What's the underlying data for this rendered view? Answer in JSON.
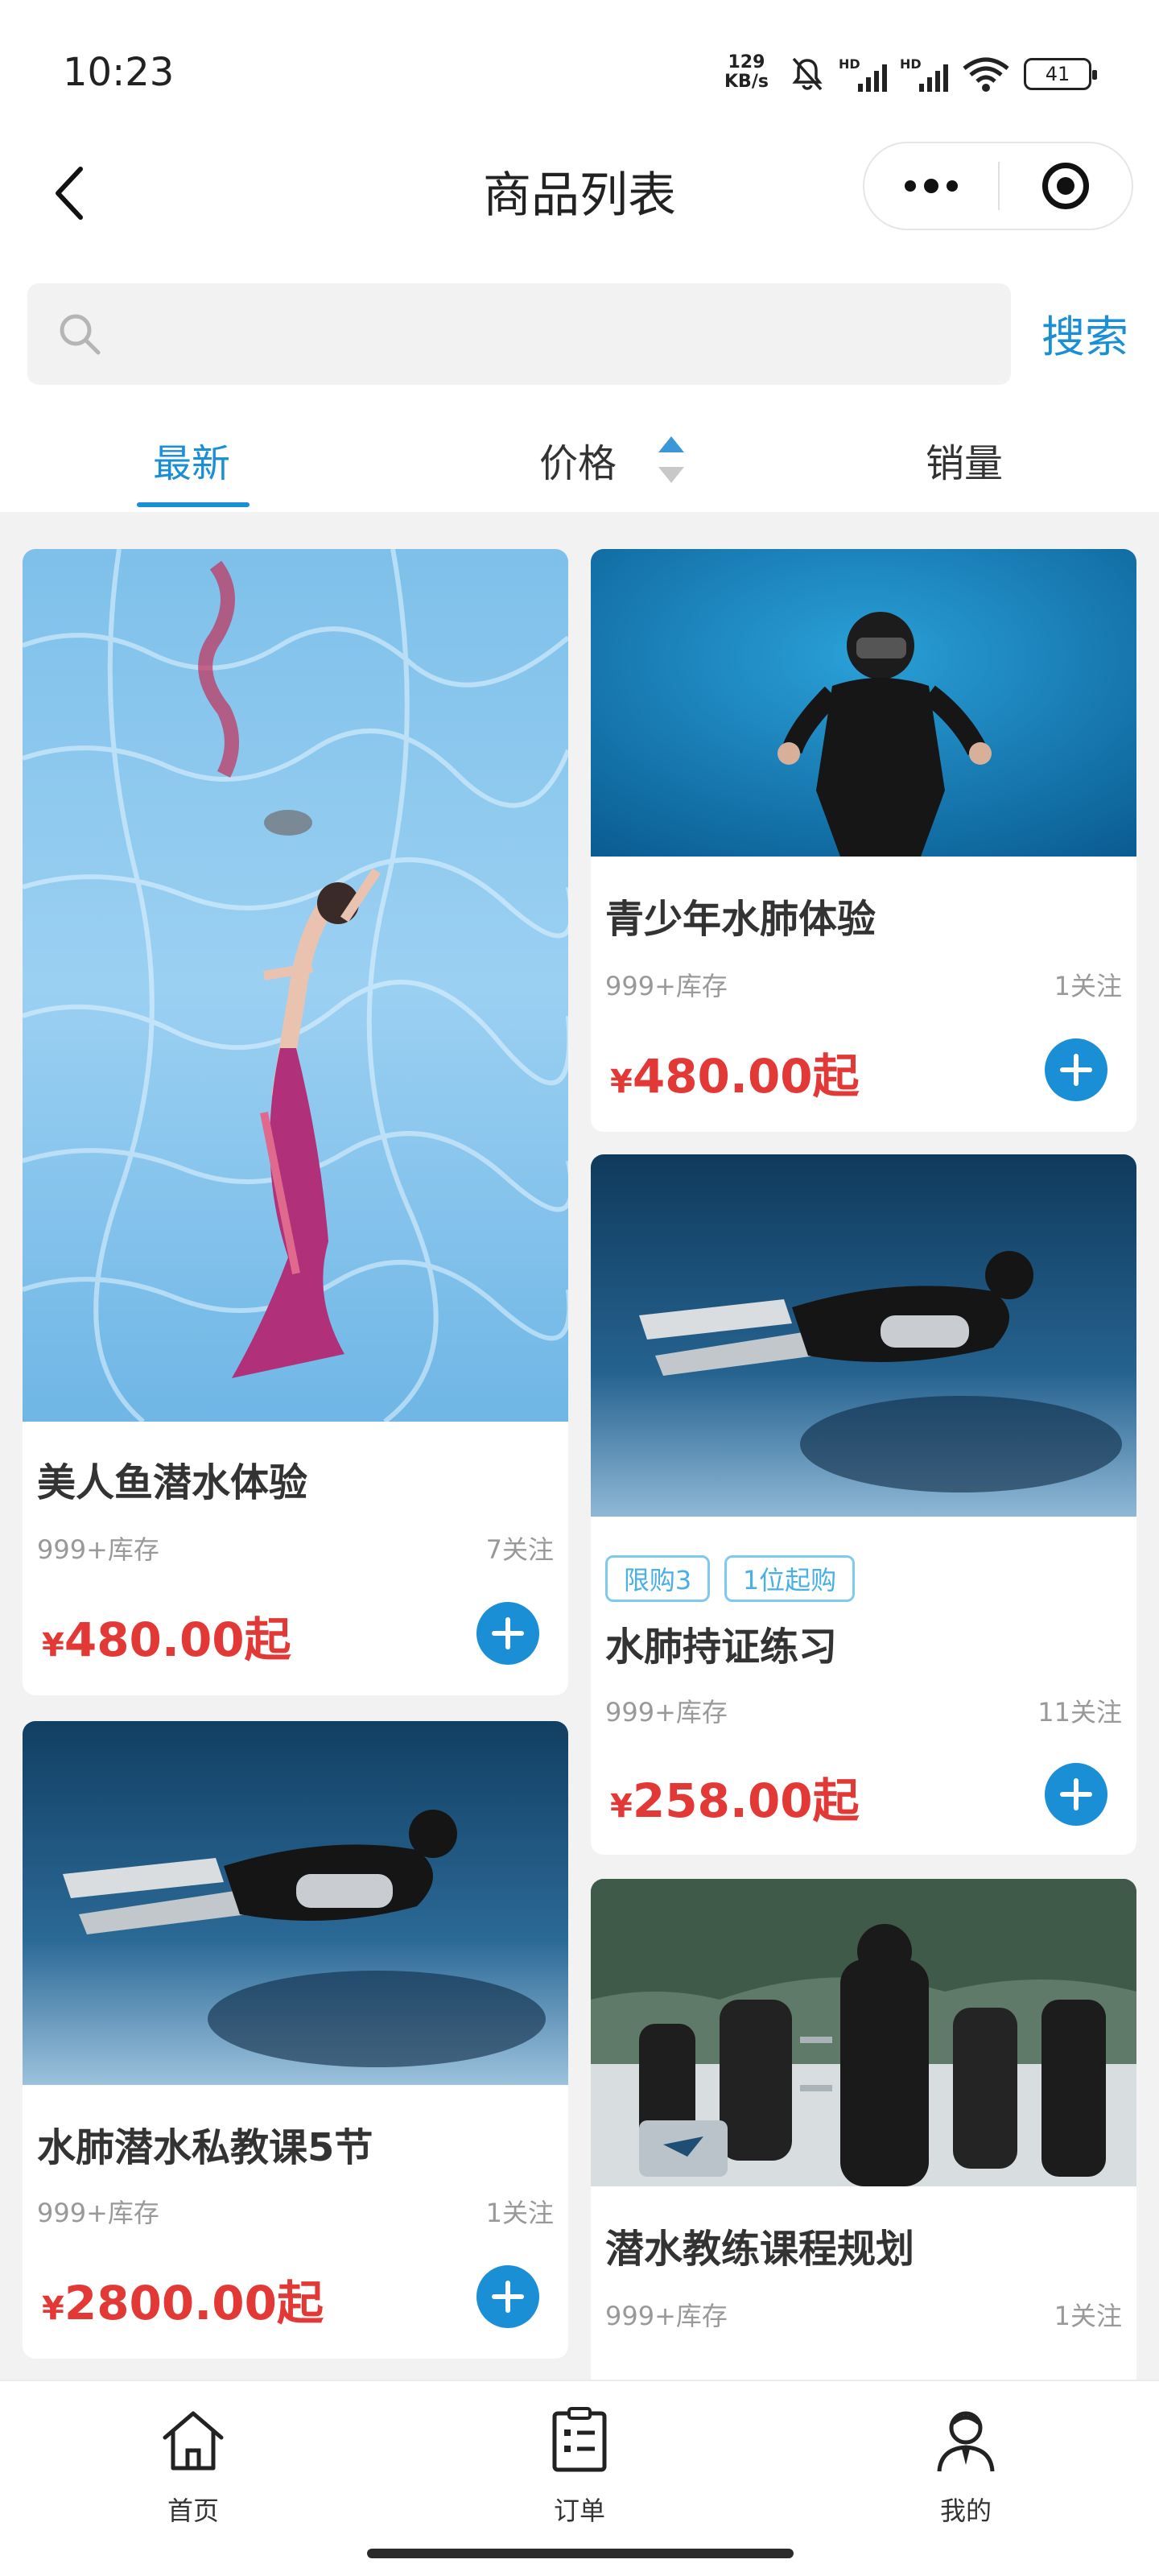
{
  "status": {
    "time": "10:23",
    "speed_value": "129",
    "speed_unit": "KB/s",
    "hd": "HD",
    "battery": "41"
  },
  "nav": {
    "title": "商品列表"
  },
  "search": {
    "placeholder": "",
    "button": "搜索"
  },
  "tabs": [
    {
      "label": "最新",
      "active": true
    },
    {
      "label": "价格"
    },
    {
      "label": "销量"
    }
  ],
  "products": [
    {
      "title": "美人鱼潜水体验",
      "stock": "999+库存",
      "follow": "7关注",
      "currency": "¥",
      "price": "480.00起"
    },
    {
      "title": "青少年水肺体验",
      "stock": "999+库存",
      "follow": "1关注",
      "currency": "¥",
      "price": "480.00起"
    },
    {
      "title": "水肺持证练习",
      "tags": [
        "限购3",
        "1位起购"
      ],
      "stock": "999+库存",
      "follow": "11关注",
      "currency": "¥",
      "price": "258.00起"
    },
    {
      "title": "水肺潜水私教课5节",
      "stock": "999+库存",
      "follow": "1关注",
      "currency": "¥",
      "price": "2800.00起"
    },
    {
      "title": "潜水教练课程规划",
      "stock": "999+库存",
      "follow": "1关注"
    }
  ],
  "tabbar": [
    {
      "label": "首页",
      "icon": "home-icon"
    },
    {
      "label": "订单",
      "icon": "order-icon"
    },
    {
      "label": "我的",
      "icon": "user-icon"
    }
  ],
  "colors": {
    "accent": "#1a8fd6",
    "price": "#e33936"
  }
}
